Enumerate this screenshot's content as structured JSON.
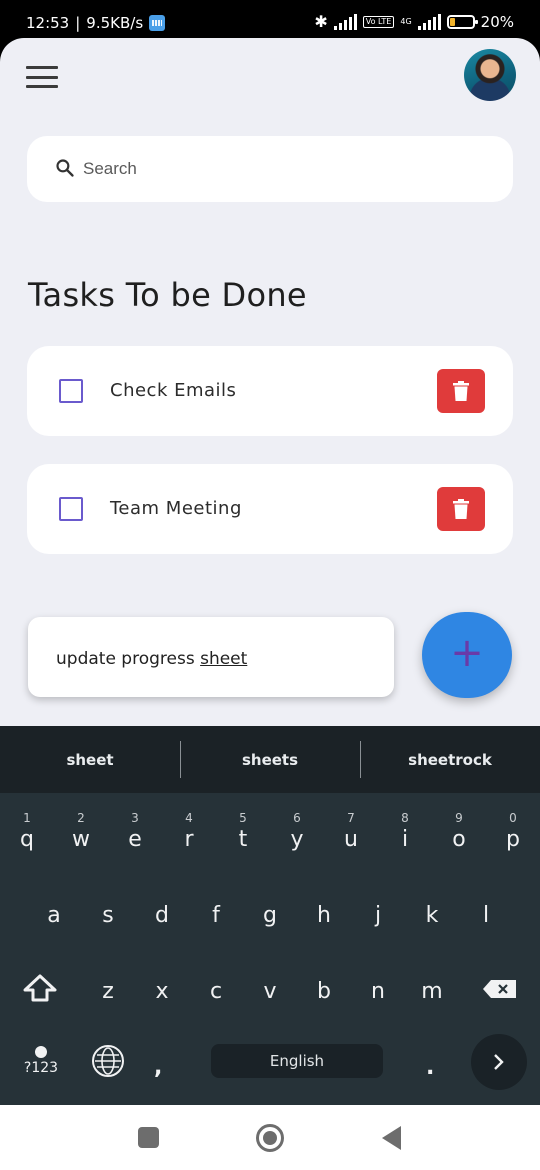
{
  "status_bar": {
    "time": "12:53",
    "net_speed": "9.5KB/s",
    "network_label": "4G",
    "volte_label": "Vo LTE",
    "battery_percent": "20%"
  },
  "header": {
    "menu_icon": "hamburger-menu-icon",
    "avatar": "user-avatar"
  },
  "search": {
    "placeholder": "Search",
    "value": ""
  },
  "main": {
    "section_title": "Tasks To be Done",
    "tasks": [
      {
        "label": "Check Emails",
        "checked": false
      },
      {
        "label": "Team Meeting",
        "checked": false
      }
    ],
    "new_task": {
      "text_prefix": "update progress ",
      "text_composing": "sheet"
    },
    "fab_label": "+",
    "colors": {
      "checkbox": "#6a5acd",
      "delete": "#e03b3b",
      "fab": "#2f86e3",
      "fab_plus": "#6a3aa8"
    }
  },
  "keyboard": {
    "suggestions": [
      "sheet",
      "sheets",
      "sheetrock"
    ],
    "row1": [
      {
        "num": "1",
        "key": "q"
      },
      {
        "num": "2",
        "key": "w"
      },
      {
        "num": "3",
        "key": "e"
      },
      {
        "num": "4",
        "key": "r"
      },
      {
        "num": "5",
        "key": "t"
      },
      {
        "num": "6",
        "key": "y"
      },
      {
        "num": "7",
        "key": "u"
      },
      {
        "num": "8",
        "key": "i"
      },
      {
        "num": "9",
        "key": "o"
      },
      {
        "num": "0",
        "key": "p"
      }
    ],
    "row2": [
      "a",
      "s",
      "d",
      "f",
      "g",
      "h",
      "j",
      "k",
      "l"
    ],
    "row3": [
      "z",
      "x",
      "c",
      "v",
      "b",
      "n",
      "m"
    ],
    "symbols_label": "?123",
    "comma": ",",
    "space_label": "English",
    "period": "."
  }
}
